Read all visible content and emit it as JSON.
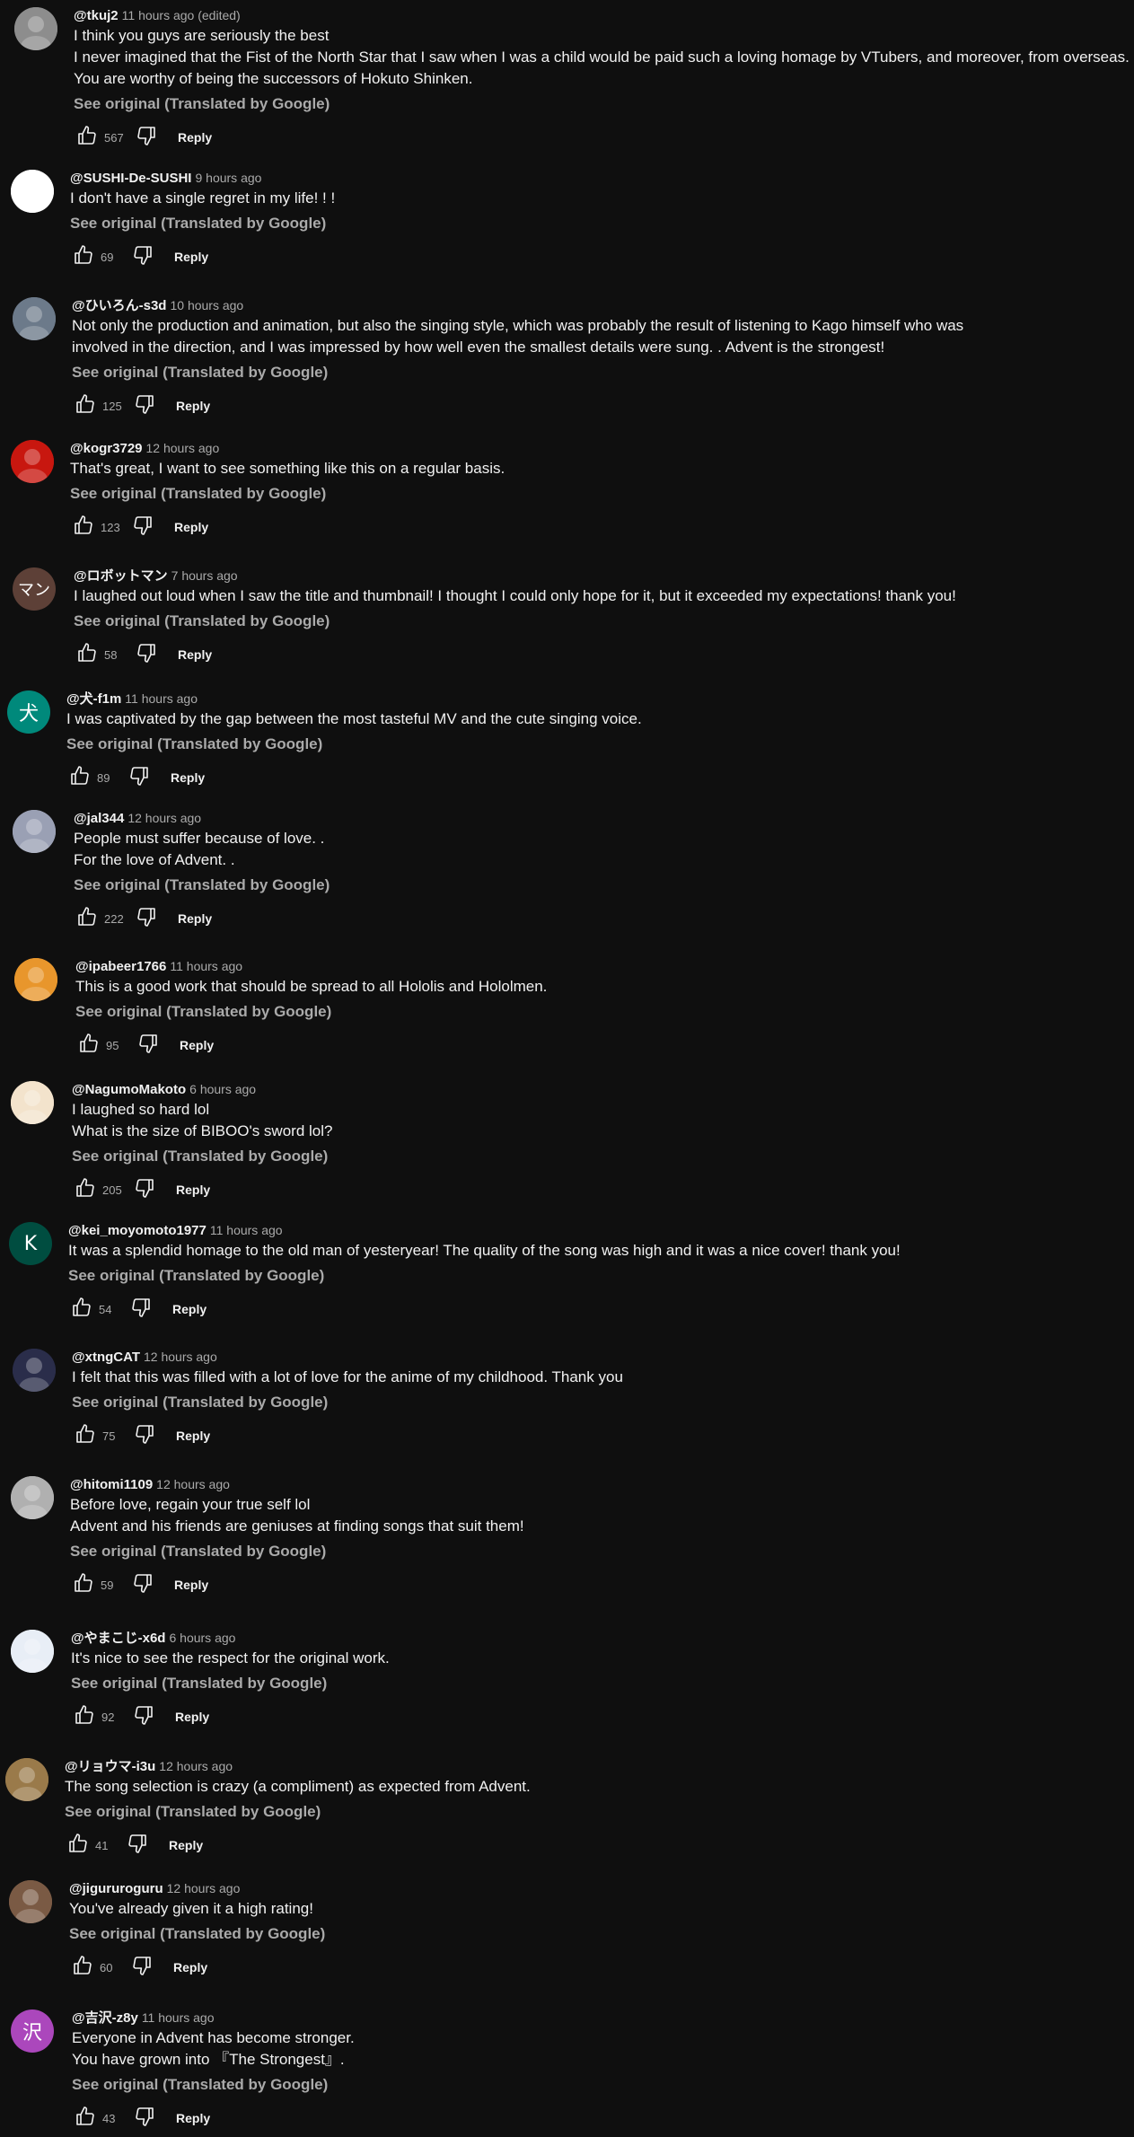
{
  "colors": {
    "background": "#0f0f0f",
    "text_primary": "#f1f1f1",
    "text_secondary": "#aaaaaa"
  },
  "labels": {
    "see_original": "See original (Translated by Google)",
    "reply": "Reply"
  },
  "icons": {
    "like": "thumbs-up-icon",
    "dislike": "thumbs-down-icon"
  },
  "comments": [
    {
      "author": "@tkuj2",
      "time": "11 hours ago (edited)",
      "lines": [
        "I think you guys are seriously the best",
        "I never imagined that the Fist of the North Star that I saw when I was a child would be paid such a loving homage by VTubers, and moreover, from overseas.",
        "You are worthy of being the successors of Hokuto Shinken."
      ],
      "likes": "567",
      "avatar": {
        "kind": "image",
        "color": "#8d8d8d"
      }
    },
    {
      "author": "@SUSHI-De-SUSHI",
      "time": "9 hours ago",
      "lines": [
        "I don't have a single regret in my life! ! !"
      ],
      "likes": "69",
      "avatar": {
        "kind": "image",
        "color": "#ffffff"
      }
    },
    {
      "author": "@ひいろん-s3d",
      "time": "10 hours ago",
      "lines": [
        "Not only the production and animation, but also the singing style, which was probably the result of listening to Kago himself who was",
        "involved in the direction, and I was impressed by how well even the smallest details were sung. . Advent is the strongest!"
      ],
      "likes": "125",
      "avatar": {
        "kind": "image",
        "color": "#6c7a8a"
      }
    },
    {
      "author": "@kogr3729",
      "time": "12 hours ago",
      "lines": [
        "That's great, I want to see something like this on a regular basis."
      ],
      "likes": "123",
      "avatar": {
        "kind": "image",
        "color": "#c8170f"
      }
    },
    {
      "author": "@ロボットマン",
      "time": "7 hours ago",
      "lines": [
        "I laughed out loud when I saw the title and thumbnail! I thought I could only hope for it, but it exceeded my expectations! thank you!"
      ],
      "likes": "58",
      "avatar": {
        "kind": "letter",
        "letter": "マン",
        "color": "#5d4037"
      }
    },
    {
      "author": "@犬-f1m",
      "time": "11 hours ago",
      "lines": [
        "I was captivated by the gap between the most tasteful MV and the cute singing voice."
      ],
      "likes": "89",
      "avatar": {
        "kind": "letter",
        "letter": "犬",
        "color": "#00897b"
      }
    },
    {
      "author": "@jal344",
      "time": "12 hours ago",
      "lines": [
        "People must suffer because of love. .",
        "For the love of Advent. ."
      ],
      "likes": "222",
      "avatar": {
        "kind": "image",
        "color": "#9aa0b4"
      }
    },
    {
      "author": "@ipabeer1766",
      "time": "11 hours ago",
      "lines": [
        "This is a good work that should be spread to all Hololis and Hololmen."
      ],
      "likes": "95",
      "avatar": {
        "kind": "image",
        "color": "#e8962c"
      }
    },
    {
      "author": "@NagumoMakoto",
      "time": "6 hours ago",
      "lines": [
        "I laughed so hard lol",
        "What is the size of BIBOO's sword lol?"
      ],
      "likes": "205",
      "avatar": {
        "kind": "image",
        "color": "#f3e3cc"
      }
    },
    {
      "author": "@kei_moyomoto1977",
      "time": "11 hours ago",
      "lines": [
        "It was a splendid homage to the old man of yesteryear! The quality of the song was high and it was a nice cover! thank you!"
      ],
      "likes": "54",
      "avatar": {
        "kind": "letter",
        "letter": "K",
        "color": "#004d40"
      }
    },
    {
      "author": "@xtngCAT",
      "time": "12 hours ago",
      "lines": [
        "I felt that this was filled with a lot of love for the anime of my childhood. Thank you"
      ],
      "likes": "75",
      "avatar": {
        "kind": "image",
        "color": "#2a2d4a"
      }
    },
    {
      "author": "@hitomi1109",
      "time": "12 hours ago",
      "lines": [
        "Before love, regain your true self lol",
        "Advent and his friends are geniuses at finding songs that suit them!"
      ],
      "likes": "59",
      "avatar": {
        "kind": "image",
        "color": "#b0b0b0"
      }
    },
    {
      "author": "@やまこじ-x6d",
      "time": "6 hours ago",
      "lines": [
        "It's nice to see the respect for the original work."
      ],
      "likes": "92",
      "avatar": {
        "kind": "image",
        "color": "#e8eef6"
      }
    },
    {
      "author": "@リョウマ-i3u",
      "time": "12 hours ago",
      "lines": [
        "The song selection is crazy (a compliment) as expected from Advent."
      ],
      "likes": "41",
      "avatar": {
        "kind": "image",
        "color": "#9a7a4a"
      }
    },
    {
      "author": "@jigururoguru",
      "time": "12 hours ago",
      "lines": [
        "You've already given it a high rating!"
      ],
      "likes": "60",
      "avatar": {
        "kind": "image",
        "color": "#7a5a44"
      }
    },
    {
      "author": "@吉沢-z8y",
      "time": "11 hours ago",
      "lines": [
        "Everyone in Advent has become stronger.",
        "You have grown into 『The Strongest』."
      ],
      "likes": "43",
      "avatar": {
        "kind": "letter",
        "letter": "沢",
        "color": "#ab47bc"
      }
    }
  ]
}
